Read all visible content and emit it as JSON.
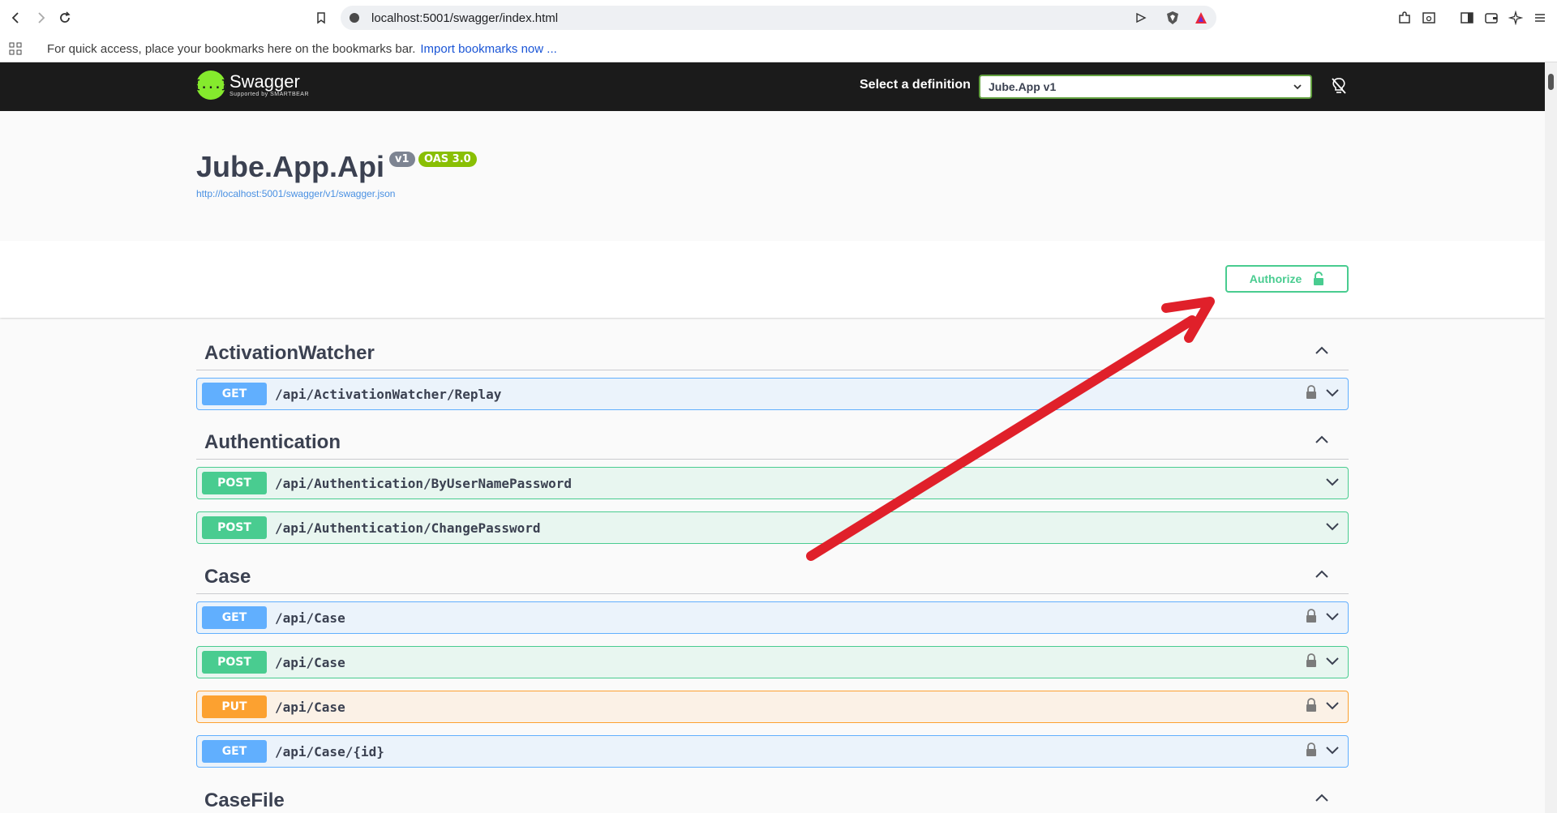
{
  "browser": {
    "url": "localhost:5001/swagger/index.html",
    "bookmarks_message": "For quick access, place your bookmarks here on the bookmarks bar.",
    "import_bookmarks": "Import bookmarks now ..."
  },
  "topbar": {
    "logo_text": "Swagger",
    "logo_subtext": "Supported by SMARTBEAR",
    "logo_glyph": "{...}",
    "definition_label": "Select a definition",
    "definition_value": "Jube.App v1"
  },
  "info": {
    "title": "Jube.App.Api",
    "version_badge": "v1",
    "oas_badge": "OAS 3.0",
    "spec_url": "http://localhost:5001/swagger/v1/swagger.json"
  },
  "authorize": {
    "label": "Authorize"
  },
  "tags": [
    {
      "name": "ActivationWatcher"
    },
    {
      "name": "Authentication"
    },
    {
      "name": "Case"
    },
    {
      "name": "CaseFile"
    }
  ],
  "operations": [
    {
      "method": "GET",
      "path": "/api/ActivationWatcher/Replay",
      "locked": true
    },
    {
      "method": "POST",
      "path": "/api/Authentication/ByUserNamePassword",
      "locked": false
    },
    {
      "method": "POST",
      "path": "/api/Authentication/ChangePassword",
      "locked": false
    },
    {
      "method": "GET",
      "path": "/api/Case",
      "locked": true
    },
    {
      "method": "POST",
      "path": "/api/Case",
      "locked": true
    },
    {
      "method": "PUT",
      "path": "/api/Case",
      "locked": true
    },
    {
      "method": "GET",
      "path": "/api/Case/{id}",
      "locked": true
    }
  ],
  "colors": {
    "get": "#61affe",
    "post": "#49cc90",
    "put": "#fca130",
    "topbar": "#1b1b1b",
    "annotation_arrow": "#e0202a"
  }
}
